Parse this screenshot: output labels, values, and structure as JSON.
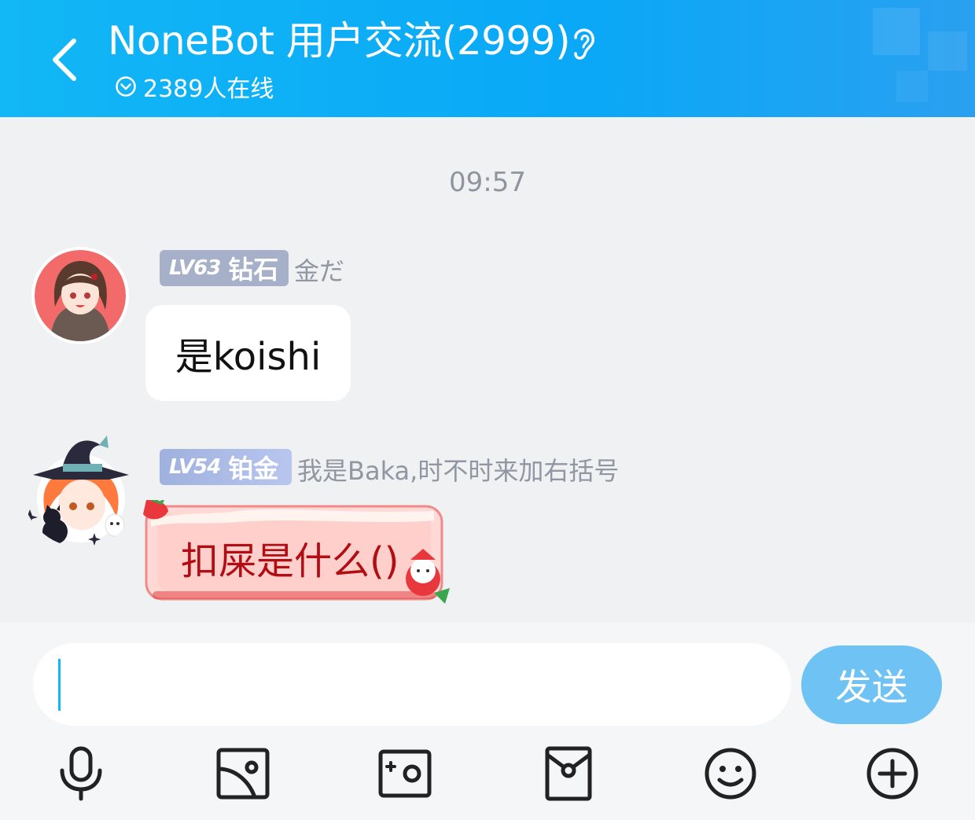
{
  "header": {
    "title": "NoneBot 用户交流(2999)",
    "online": "2389人在线",
    "background": "#12b7f5"
  },
  "chat": {
    "timestamp": "09:57",
    "messages": [
      {
        "level": "LV63",
        "title": "钻石",
        "nickname": "金だ",
        "text": "是koishi",
        "badge_color": "#a6b0c8"
      },
      {
        "level": "LV54",
        "title": "铂金",
        "nickname": "我是Baka,时不时来加右括号",
        "text": "扣屎是什么()",
        "badge_color": "#9fb1de"
      }
    ]
  },
  "composer": {
    "input_value": "",
    "send_label": "发送",
    "send_color": "#6fc3f4"
  },
  "toolbar": {
    "icons": [
      "microphone-icon",
      "image-icon",
      "camera-icon",
      "red-packet-icon",
      "emoji-icon",
      "plus-icon"
    ]
  }
}
